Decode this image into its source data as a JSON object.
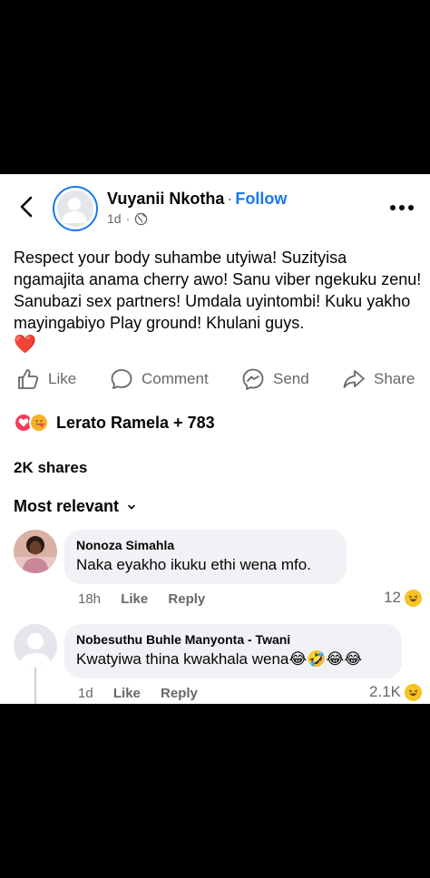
{
  "post": {
    "author": "Vuyanii Nkotha",
    "separator": "·",
    "follow_label": "Follow",
    "time": "1d",
    "privacy_icon": "globe-icon",
    "text": "Respect your body suhambe utyiwa! Suzityisa ngamajita anama cherry awo! Sanu viber ngekuku zenu! Sanubazi sex partners! Umdala uyintombi! Kuku yakho mayingabiyo Play ground! Khulani guys.",
    "text_emoji": "❤️"
  },
  "actions": {
    "like_label": "Like",
    "comment_label": "Comment",
    "send_label": "Send",
    "share_label": "Share"
  },
  "reactions": {
    "summary": "Lerato Ramela + 783",
    "icons": [
      "love-icon",
      "care-icon"
    ]
  },
  "shares": {
    "label": "2K shares"
  },
  "sort": {
    "label": "Most relevant"
  },
  "comments": [
    {
      "author": "Nonoza Simahla",
      "text": "Naka eyakho ikuku ethi wena mfo.",
      "time": "18h",
      "like_label": "Like",
      "reply_label": "Reply",
      "reaction_count": "12"
    },
    {
      "author": "Nobesuthu Buhle Manyonta - Twani",
      "text": "Kwatyiwa thina kwakhala wena",
      "text_emoji": "😂🤣😂😂",
      "time": "1d",
      "like_label": "Like",
      "reply_label": "Reply",
      "reaction_count": "2.1K"
    }
  ],
  "colors": {
    "accent": "#1877f2",
    "secondary_text": "#65676b",
    "bubble": "#f0f2f5",
    "love": "#f33e58",
    "heart": "#e41e3f"
  }
}
